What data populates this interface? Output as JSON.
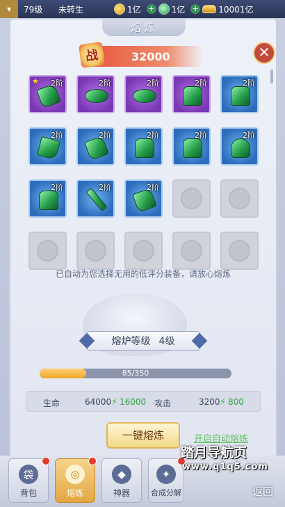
{
  "topbar": {
    "menu_icon": "chevron-down-icon",
    "level": "79级",
    "rebirth": "未转生",
    "gold": "1亿",
    "jade": "1亿",
    "ingot": "10001亿"
  },
  "panel": {
    "title": "熔炼",
    "power_icon_text": "战",
    "power_value": "32000"
  },
  "slots": [
    {
      "type": "purple",
      "tier": "2阶",
      "star": true,
      "item": "glove"
    },
    {
      "type": "purple",
      "tier": "2阶",
      "star": false,
      "item": "belt"
    },
    {
      "type": "purple",
      "tier": "2阶",
      "star": false,
      "item": "belt"
    },
    {
      "type": "purple",
      "tier": "2阶",
      "star": false,
      "item": "armor"
    },
    {
      "type": "blue",
      "tier": "2阶",
      "star": false,
      "item": "armor"
    },
    {
      "type": "blue",
      "tier": "2阶",
      "star": false,
      "item": "boot"
    },
    {
      "type": "blue",
      "tier": "2阶",
      "star": false,
      "item": "glove"
    },
    {
      "type": "blue",
      "tier": "2阶",
      "star": false,
      "item": "armor"
    },
    {
      "type": "blue",
      "tier": "2阶",
      "star": false,
      "item": "armor"
    },
    {
      "type": "blue",
      "tier": "2阶",
      "star": false,
      "item": "helm"
    },
    {
      "type": "blue",
      "tier": "2阶",
      "star": false,
      "item": "armor"
    },
    {
      "type": "blue",
      "tier": "2阶",
      "star": false,
      "item": "blade"
    },
    {
      "type": "blue",
      "tier": "2阶",
      "star": false,
      "item": "glove"
    },
    {
      "type": "empty"
    },
    {
      "type": "empty"
    },
    {
      "type": "empty"
    },
    {
      "type": "empty"
    },
    {
      "type": "empty"
    },
    {
      "type": "empty"
    },
    {
      "type": "empty"
    }
  ],
  "hint": "已自动为您选择无用的低评分装备，请放心熔炼",
  "furnace": {
    "label": "熔炉等级",
    "level": "4级",
    "progress_text": "85/350",
    "progress_fraction": 0.243
  },
  "stats": {
    "hp_label": "生命",
    "hp_value": "64000",
    "hp_gain": "16000",
    "atk_label": "攻击",
    "atk_value": "3200",
    "atk_gain": "800"
  },
  "actions": {
    "oneclick_label": "一键熔炼",
    "auto_label": "开启自动熔炼"
  },
  "tabs": [
    {
      "label": "背包",
      "icon": "bag-icon",
      "active": false,
      "dot": true
    },
    {
      "label": "熔炼",
      "icon": "smelt-icon",
      "active": true,
      "dot": true
    },
    {
      "label": "神器",
      "icon": "artifact-icon",
      "active": false,
      "dot": false
    },
    {
      "label": "合成分解",
      "icon": "compose-icon",
      "active": false,
      "dot": true
    }
  ],
  "watermark": {
    "title": "踏月导航页",
    "url": "www.q1q5.com"
  },
  "back_label": "返回",
  "colors": {
    "accent_gold": "#f2d888",
    "power_red": "#e5523b",
    "gain_green": "#31a23e"
  }
}
